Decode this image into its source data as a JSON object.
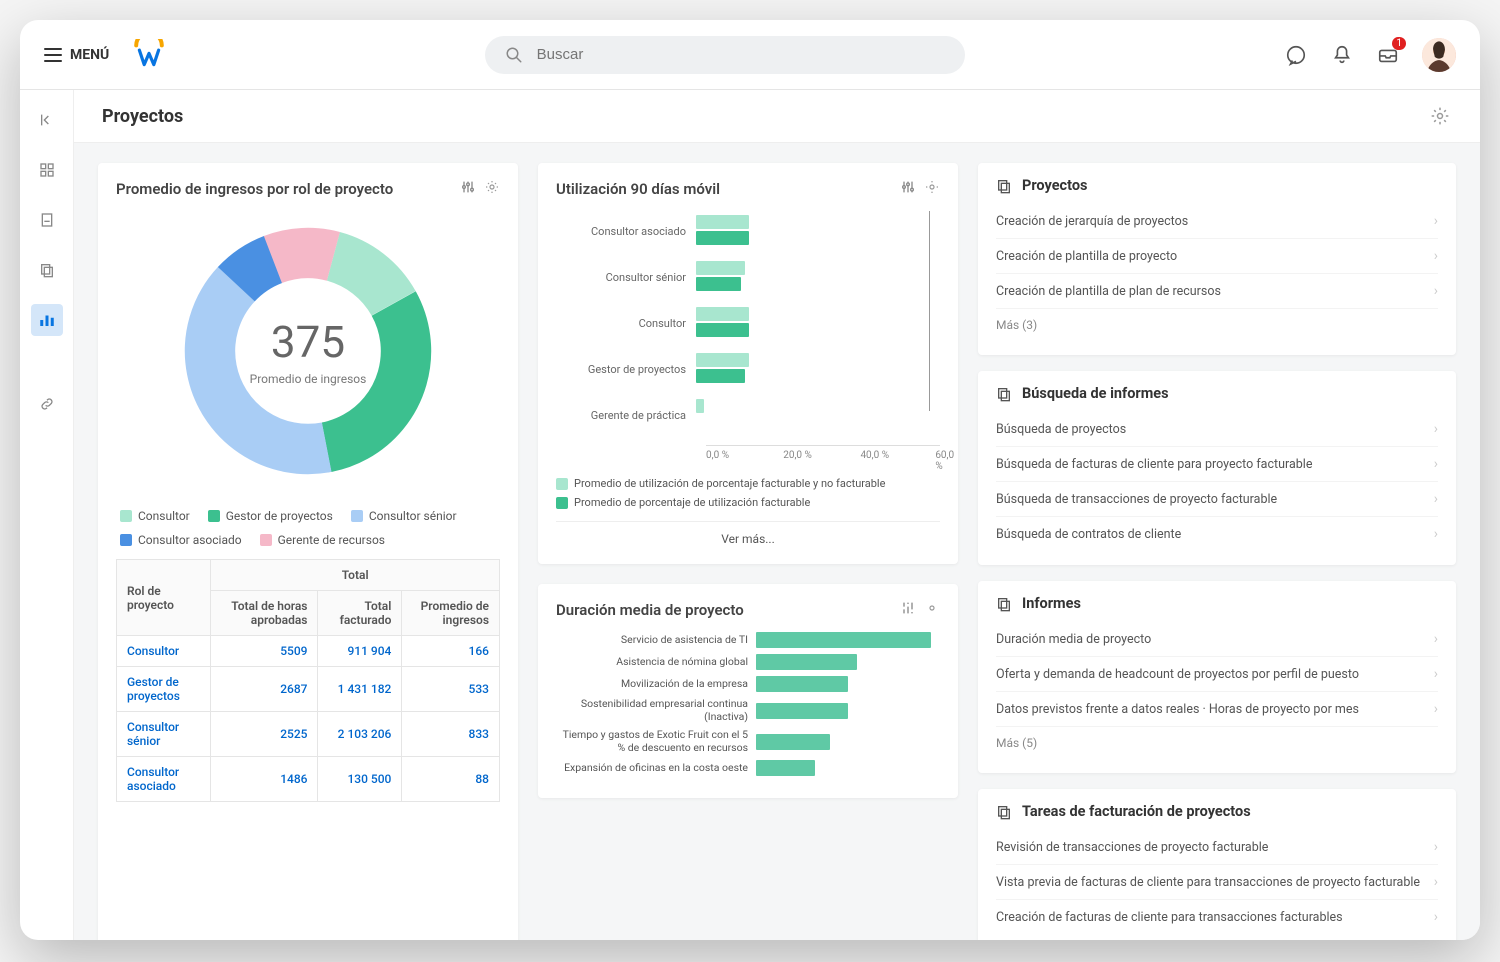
{
  "header": {
    "menu_label": "MENÚ",
    "search_placeholder": "Buscar",
    "inbox_badge": "1"
  },
  "page": {
    "title": "Proyectos"
  },
  "colors": {
    "teal_light": "#a8e6cf",
    "teal": "#3cc08f",
    "blue_light": "#a9cdf5",
    "blue": "#4a90e2",
    "pink": "#f5b8c8"
  },
  "card_donut": {
    "title": "Promedio de ingresos por rol de proyecto",
    "center_value": "375",
    "center_label": "Promedio de ingresos",
    "legend": [
      {
        "label": "Consultor",
        "color": "#a8e6cf"
      },
      {
        "label": "Gestor de proyectos",
        "color": "#3cc08f"
      },
      {
        "label": "Consultor sénior",
        "color": "#a9cdf5"
      },
      {
        "label": "Consultor asociado",
        "color": "#4a90e2"
      },
      {
        "label": "Gerente de recursos",
        "color": "#f5b8c8"
      }
    ],
    "table": {
      "group_header": "Total",
      "headers": [
        "Rol de proyecto",
        "Total de horas aprobadas",
        "Total facturado",
        "Promedio de ingresos"
      ],
      "rows": [
        {
          "role": "Consultor",
          "hours": "5509",
          "billed": "911 904",
          "avg": "166"
        },
        {
          "role": "Gestor de proyectos",
          "hours": "2687",
          "billed": "1 431 182",
          "avg": "533"
        },
        {
          "role": "Consultor sénior",
          "hours": "2525",
          "billed": "2 103 206",
          "avg": "833"
        },
        {
          "role": "Consultor asociado",
          "hours": "1486",
          "billed": "130 500",
          "avg": "88"
        }
      ]
    }
  },
  "card_util": {
    "title": "Utilización 90 días móvil",
    "axis": [
      "0,0 %",
      "20,0 %",
      "40,0 %",
      "60,0 %"
    ],
    "legend": [
      {
        "label": "Promedio de utilización de porcentaje facturable y no facturable",
        "color": "#a8e6cf"
      },
      {
        "label": "Promedio de porcentaje de utilización facturable",
        "color": "#3cc08f"
      }
    ],
    "rows": [
      {
        "label": "Consultor asociado",
        "light": 13,
        "dark": 13
      },
      {
        "label": "Consultor sénior",
        "light": 12,
        "dark": 11
      },
      {
        "label": "Consultor",
        "light": 13,
        "dark": 13
      },
      {
        "label": "Gestor de proyectos",
        "light": 13,
        "dark": 12
      },
      {
        "label": "Gerente de práctica",
        "light": 2,
        "dark": 0
      }
    ],
    "ver_mas": "Ver más..."
  },
  "card_dur": {
    "title": "Duración media de proyecto",
    "rows": [
      {
        "label": "Servicio de asistencia de TI",
        "value": 95
      },
      {
        "label": "Asistencia de nómina global",
        "value": 55
      },
      {
        "label": "Movilización de la empresa",
        "value": 50
      },
      {
        "label": "Sostenibilidad empresarial continua (Inactiva)",
        "value": 50
      },
      {
        "label": "Tiempo y gastos de Exotic Fruit con el 5 % de descuento en recursos",
        "value": 40
      },
      {
        "label": "Expansión de oficinas en la costa oeste",
        "value": 32
      }
    ]
  },
  "right": {
    "sections": [
      {
        "title": "Proyectos",
        "items": [
          "Creación de jerarquía de proyectos",
          "Creación de plantilla de proyecto",
          "Creación de plantilla de plan de recursos"
        ],
        "more": "Más (3)"
      },
      {
        "title": "Búsqueda de informes",
        "items": [
          "Búsqueda de proyectos",
          "Búsqueda de facturas de cliente para proyecto facturable",
          "Búsqueda de transacciones de proyecto facturable",
          "Búsqueda de contratos de cliente"
        ]
      },
      {
        "title": "Informes",
        "items": [
          "Duración media de proyecto",
          "Oferta y demanda de headcount de proyectos por perfil de puesto",
          "Datos previstos frente a datos reales · Horas de proyecto por mes"
        ],
        "more": "Más (5)"
      },
      {
        "title": "Tareas de facturación de proyectos",
        "items": [
          "Revisión de transacciones de proyecto facturable",
          "Vista previa de facturas de cliente para transacciones de proyecto facturable",
          "Creación de facturas de cliente para transacciones facturables"
        ]
      }
    ]
  },
  "chart_data": [
    {
      "type": "pie",
      "title": "Promedio de ingresos por rol de proyecto",
      "center_value": 375,
      "center_label": "Promedio de ingresos",
      "series": [
        {
          "name": "Consultor",
          "value": 166
        },
        {
          "name": "Gestor de proyectos",
          "value": 533
        },
        {
          "name": "Consultor sénior",
          "value": 833
        },
        {
          "name": "Consultor asociado",
          "value": 88
        },
        {
          "name": "Gerente de recursos",
          "value": 255
        }
      ]
    },
    {
      "type": "bar",
      "title": "Utilización 90 días móvil",
      "orientation": "horizontal",
      "xlabel": "",
      "ylabel": "",
      "xlim": [
        0,
        60
      ],
      "categories": [
        "Consultor asociado",
        "Consultor sénior",
        "Consultor",
        "Gestor de proyectos",
        "Gerente de práctica"
      ],
      "series": [
        {
          "name": "Promedio de utilización de porcentaje facturable y no facturable",
          "values": [
            13,
            12,
            13,
            13,
            2
          ]
        },
        {
          "name": "Promedio de porcentaje de utilización facturable",
          "values": [
            13,
            11,
            13,
            12,
            0
          ]
        }
      ]
    },
    {
      "type": "bar",
      "title": "Duración media de proyecto",
      "orientation": "horizontal",
      "categories": [
        "Servicio de asistencia de TI",
        "Asistencia de nómina global",
        "Movilización de la empresa",
        "Sostenibilidad empresarial continua (Inactiva)",
        "Tiempo y gastos de Exotic Fruit con el 5 % de descuento en recursos",
        "Expansión de oficinas en la costa oeste"
      ],
      "values": [
        95,
        55,
        50,
        50,
        40,
        32
      ]
    }
  ]
}
